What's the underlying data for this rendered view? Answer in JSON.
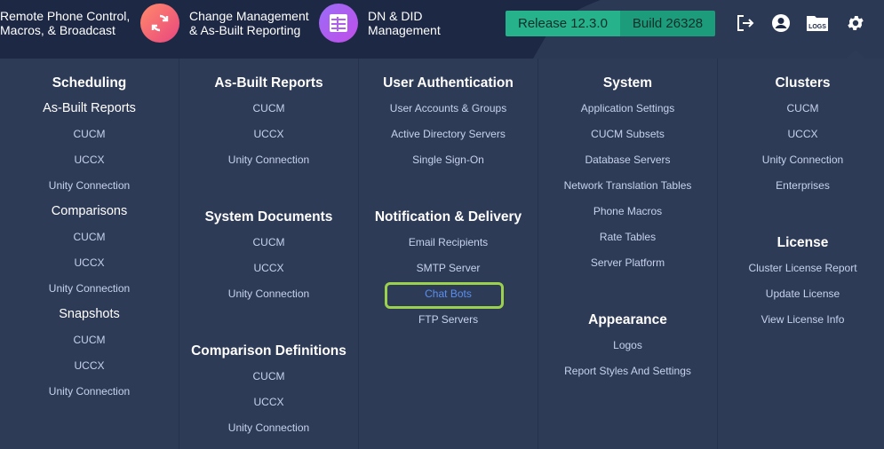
{
  "header": {
    "nav": [
      {
        "label": "Remote Phone Control,\nMacros, & Broadcast",
        "icon": "phone-control"
      },
      {
        "label": "Change Management\n& As-Built Reporting",
        "icon": "sync-icon"
      },
      {
        "label": "DN & DID\nManagement",
        "icon": "table-icon"
      }
    ],
    "release": "Release 12.3.0",
    "build": "Build 26328",
    "icons": [
      "logout-icon",
      "user-icon",
      "logs-icon",
      "gear-icon"
    ],
    "logs_text": "LOGS"
  },
  "columns": [
    {
      "sections": [
        {
          "title": "Scheduling",
          "items": []
        },
        {
          "title": "As-Built Reports",
          "sub": true,
          "items": [
            "CUCM",
            "UCCX",
            "Unity Connection"
          ]
        },
        {
          "title": "Comparisons",
          "sub": true,
          "items": [
            "CUCM",
            "UCCX",
            "Unity Connection"
          ]
        },
        {
          "title": "Snapshots",
          "sub": true,
          "items": [
            "CUCM",
            "UCCX",
            "Unity Connection"
          ]
        }
      ]
    },
    {
      "sections": [
        {
          "title": "As-Built Reports",
          "items": [
            "CUCM",
            "UCCX",
            "Unity Connection"
          ]
        },
        {
          "title": "System Documents",
          "items": [
            "CUCM",
            "UCCX",
            "Unity Connection"
          ]
        },
        {
          "title": "Comparison Definitions",
          "items": [
            "CUCM",
            "UCCX",
            "Unity Connection"
          ]
        }
      ]
    },
    {
      "sections": [
        {
          "title": "User Authentication",
          "items": [
            "User Accounts & Groups",
            "Active Directory Servers",
            "Single Sign-On"
          ]
        },
        {
          "title": "Notification & Delivery",
          "items": [
            "Email Recipients",
            "SMTP Server",
            "Chat Bots",
            "FTP Servers"
          ]
        }
      ]
    },
    {
      "sections": [
        {
          "title": "System",
          "items": [
            "Application Settings",
            "CUCM Subsets",
            "Database Servers",
            "Network Translation Tables",
            "Phone Macros",
            "Rate Tables",
            "Server Platform"
          ]
        },
        {
          "title": "Appearance",
          "items": [
            "Logos",
            "Report Styles And Settings"
          ]
        }
      ]
    },
    {
      "sections": [
        {
          "title": "Clusters",
          "items": [
            "CUCM",
            "UCCX",
            "Unity Connection",
            "Enterprises"
          ]
        },
        {
          "title": "License",
          "items": [
            "Cluster License Report",
            "Update License",
            "View License Info"
          ]
        }
      ]
    }
  ],
  "highlighted_item": "Chat Bots",
  "colors": {
    "header_bg": "#1d2844",
    "menu_bg": "#2e3b57",
    "accent_green": "#26b38c",
    "highlight": "#9bd14c",
    "link": "#c6d2ee",
    "active_link": "#5a8ff0"
  }
}
